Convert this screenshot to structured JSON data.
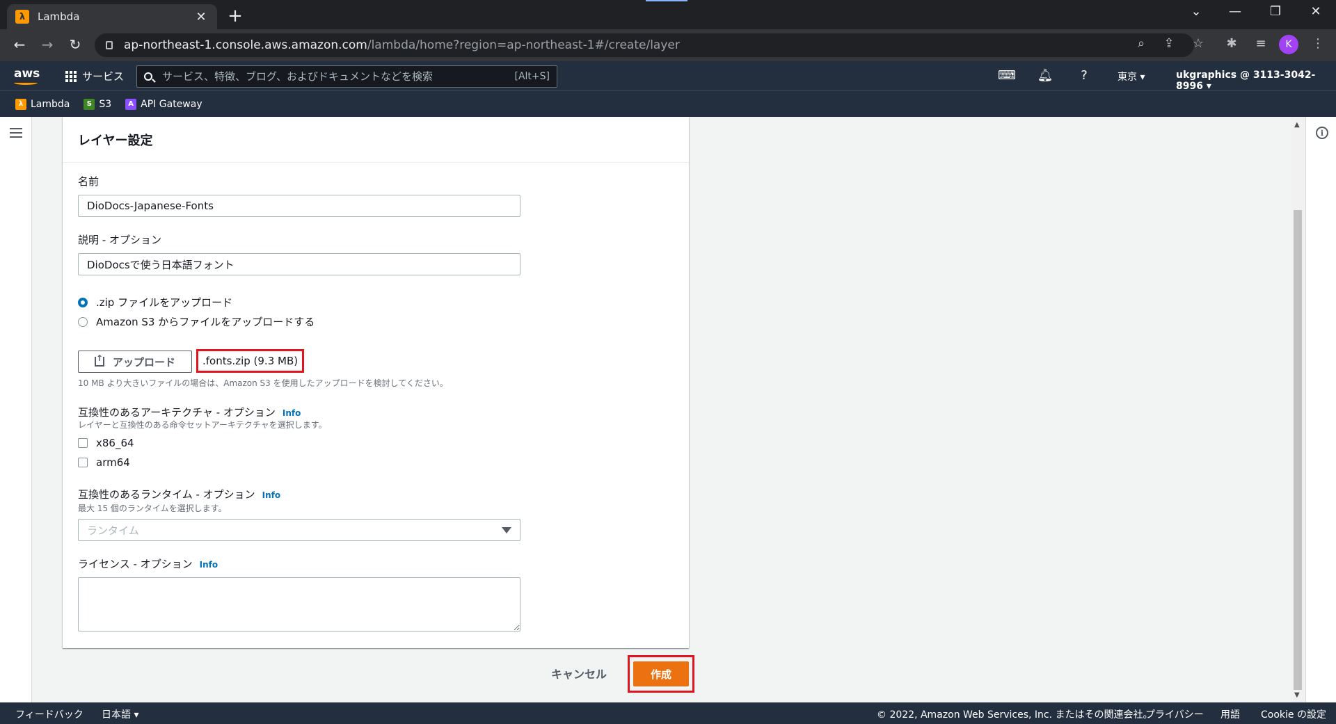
{
  "browser": {
    "tab_title": "Lambda",
    "tab_icon": "λ",
    "url_host": "ap-northeast-1.console.aws.amazon.com",
    "url_path": "/lambda/home?region=ap-northeast-1#/create/layer",
    "profile_initial": "K"
  },
  "aws_nav": {
    "logo": "aws",
    "services_label": "サービス",
    "search_placeholder": "サービス、特徴、ブログ、およびドキュメントなどを検索",
    "search_shortcut": "[Alt+S]",
    "region": "東京 ▾",
    "account": "ukgraphics @ 3113-3042-8996 ▾"
  },
  "favorites": [
    {
      "label": "Lambda",
      "color": "#ff9900",
      "glyph": "λ"
    },
    {
      "label": "S3",
      "color": "#3f8624",
      "glyph": "S"
    },
    {
      "label": "API Gateway",
      "color": "#8c4fff",
      "glyph": "A"
    }
  ],
  "form": {
    "section_title": "レイヤー設定",
    "name_label": "名前",
    "name_value": "DioDocs-Japanese-Fonts",
    "desc_label": "説明 - オプション",
    "desc_value": "DioDocsで使う日本語フォント",
    "radio_zip": ".zip ファイルをアップロード",
    "radio_s3": "Amazon S3 からファイルをアップロードする",
    "upload_button": "アップロード",
    "uploaded_file": ".fonts.zip (9.3 MB)",
    "upload_hint": "10 MB より大きいファイルの場合は、Amazon S3 を使用したアップロードを検討してください。",
    "arch_label": "互換性のあるアーキテクチャ - オプション",
    "arch_desc": "レイヤーと互換性のある命令セットアーキテクチャを選択します。",
    "arch_x86": "x86_64",
    "arch_arm": "arm64",
    "runtime_label": "互換性のあるランタイム - オプション",
    "runtime_desc": "最大 15 個のランタイムを選択します。",
    "runtime_placeholder": "ランタイム",
    "license_label": "ライセンス - オプション",
    "info": "Info"
  },
  "actions": {
    "cancel": "キャンセル",
    "create": "作成"
  },
  "footer": {
    "feedback": "フィードバック",
    "language": "日本語 ▾",
    "copyright": "© 2022, Amazon Web Services, Inc. またはその関連会社。",
    "privacy": "プライバシー",
    "terms": "用語",
    "cookie": "Cookie の設定"
  }
}
